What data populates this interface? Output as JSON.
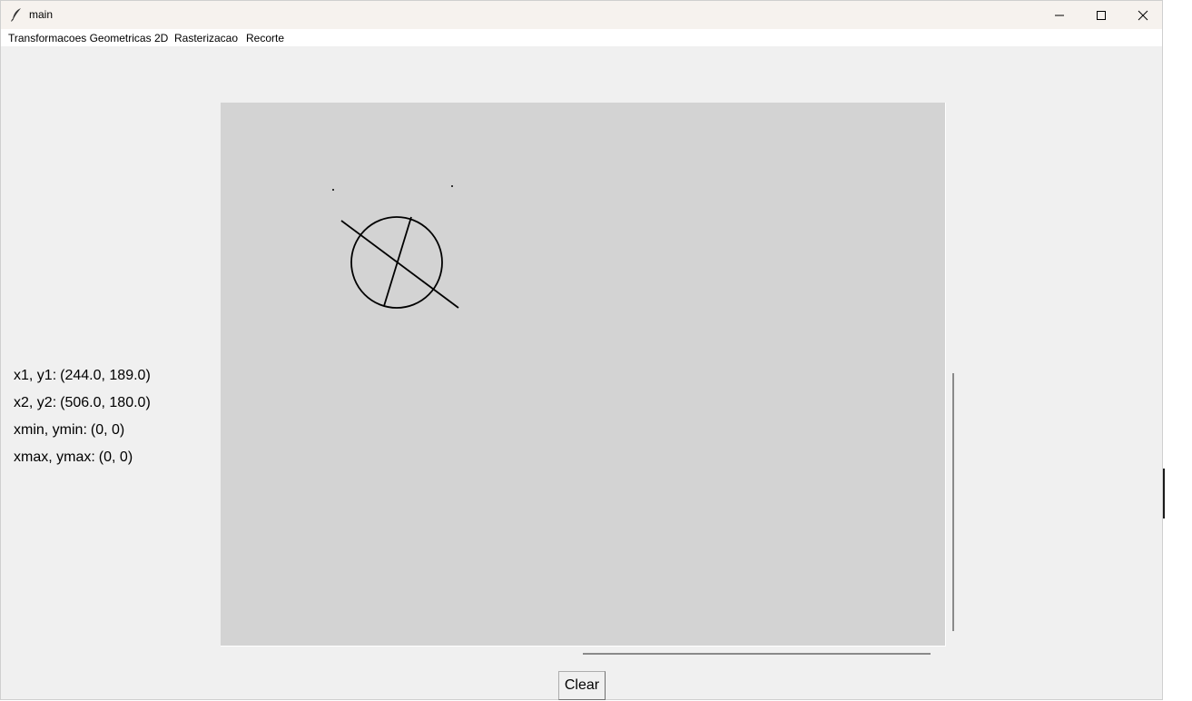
{
  "window": {
    "title": "main",
    "icon": "feather-icon",
    "controls": {
      "minimize_icon": "minimize-icon",
      "maximize_icon": "maximize-icon",
      "close_icon": "close-icon"
    }
  },
  "menubar": {
    "items": [
      {
        "label": "Transformacoes Geometricas 2D"
      },
      {
        "label": "Rasterizacao"
      },
      {
        "label": "Recorte"
      }
    ]
  },
  "info": {
    "p1_label": "x1, y1:",
    "p1_value": "(244.0, 189.0)",
    "p2_label": "x2, y2:",
    "p2_value": "(506.0, 180.0)",
    "min_label": "xmin, ymin:",
    "min_value": "(0, 0)",
    "max_label": "xmax, ymax:",
    "max_value": "(0, 0)"
  },
  "canvas": {
    "background": "#d3d3d3",
    "stroke": "#000000"
  },
  "buttons": {
    "clear_label": "Clear"
  }
}
